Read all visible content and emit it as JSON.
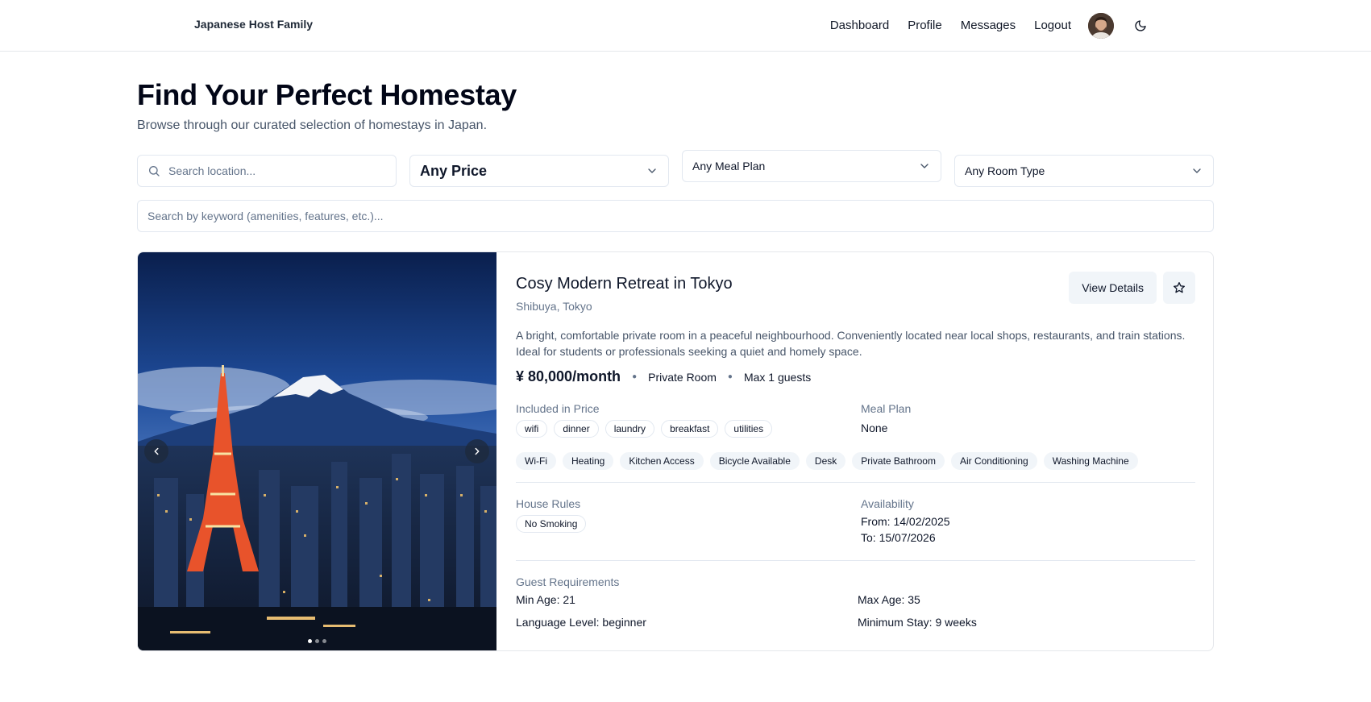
{
  "nav": {
    "brand": "Japanese Host Family",
    "links": [
      "Dashboard",
      "Profile",
      "Messages",
      "Logout"
    ]
  },
  "header": {
    "title": "Find Your Perfect Homestay",
    "subtitle": "Browse through our curated selection of homestays in Japan."
  },
  "filters": {
    "location_placeholder": "Search location...",
    "price": "Any Price",
    "meal_plan": "Any Meal Plan",
    "room_type": "Any Room Type",
    "keyword_placeholder": "Search by keyword (amenities, features, etc.)..."
  },
  "listing": {
    "title": "Cosy Modern Retreat in Tokyo",
    "location": "Shibuya, Tokyo",
    "view_details": "View Details",
    "description": "A bright, comfortable private room in a peaceful neighbourhood. Conveniently located near local shops, restaurants, and train stations. Ideal for students or professionals seeking a quiet and homely space.",
    "price": "¥ 80,000/month",
    "room_type": "Private Room",
    "max_guests": "Max 1 guests",
    "included_label": "Included in Price",
    "included": [
      "wifi",
      "dinner",
      "laundry",
      "breakfast",
      "utilities"
    ],
    "meal_plan_label": "Meal Plan",
    "meal_plan": "None",
    "amenities": [
      "Wi-Fi",
      "Heating",
      "Kitchen Access",
      "Bicycle Available",
      "Desk",
      "Private Bathroom",
      "Air Conditioning",
      "Washing Machine"
    ],
    "house_rules_label": "House Rules",
    "house_rules": [
      "No Smoking"
    ],
    "availability_label": "Availability",
    "available_from": "From: 14/02/2025",
    "available_to": "To: 15/07/2026",
    "guest_req_label": "Guest Requirements",
    "min_age": "Min Age: 21",
    "max_age": "Max Age: 35",
    "language_level": "Language Level: beginner",
    "minimum_stay": "Minimum Stay: 9 weeks",
    "photo_count": 3,
    "active_photo": 1
  },
  "icons": {
    "search": "search-icon",
    "chevron": "chevron-down-icon",
    "star": "star-icon",
    "theme": "moon-icon",
    "prev": "chevron-left-icon",
    "next": "chevron-right-icon"
  },
  "colors": {
    "muted": "#64748b",
    "border": "#e2e8f0",
    "button_bg": "#f1f5f9"
  }
}
